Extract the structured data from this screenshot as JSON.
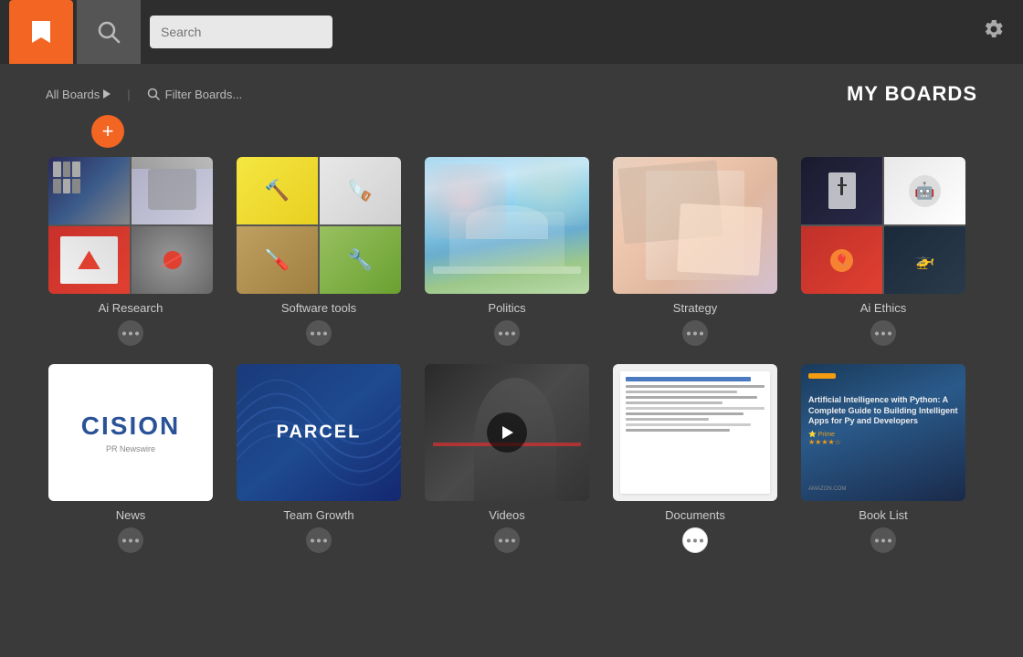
{
  "topbar": {
    "search_placeholder": "Search",
    "tab_bookmark_label": "Bookmark Tab",
    "tab_search_label": "Search Tab"
  },
  "header": {
    "all_boards_label": "All Boards",
    "filter_placeholder": "Filter Boards...",
    "title": "MY BOARDS",
    "add_button_label": "+"
  },
  "boards": [
    {
      "id": "ai-research",
      "label": "Ai Research",
      "type": "collage"
    },
    {
      "id": "software-tools",
      "label": "Software tools",
      "type": "collage"
    },
    {
      "id": "politics",
      "label": "Politics",
      "type": "single"
    },
    {
      "id": "strategy",
      "label": "Strategy",
      "type": "single"
    },
    {
      "id": "ai-ethics",
      "label": "Ai Ethics",
      "type": "collage"
    },
    {
      "id": "news",
      "label": "News",
      "type": "logo"
    },
    {
      "id": "team-growth",
      "label": "Team Growth",
      "type": "parcel"
    },
    {
      "id": "videos",
      "label": "Videos",
      "type": "video"
    },
    {
      "id": "documents",
      "label": "Documents",
      "type": "document"
    },
    {
      "id": "book-list",
      "label": "Book List",
      "type": "book"
    }
  ],
  "icons": {
    "bookmark": "🔖",
    "search": "🔍",
    "gear": "⚙",
    "filter_search": "🔍",
    "ellipsis": "•••",
    "arrow_right": "▶",
    "play": "▶"
  },
  "cision": {
    "main": "CISION",
    "sub": "PR Newswire"
  },
  "parcel": {
    "text": "PARCEL"
  },
  "book": {
    "title": "Artificial Intelligence with Python: A Complete Guide to Building Intelligent Apps for Py and Developers",
    "prime": "⭐ Prime",
    "stars": "★★★★☆",
    "source": "AMAZON.COM"
  }
}
